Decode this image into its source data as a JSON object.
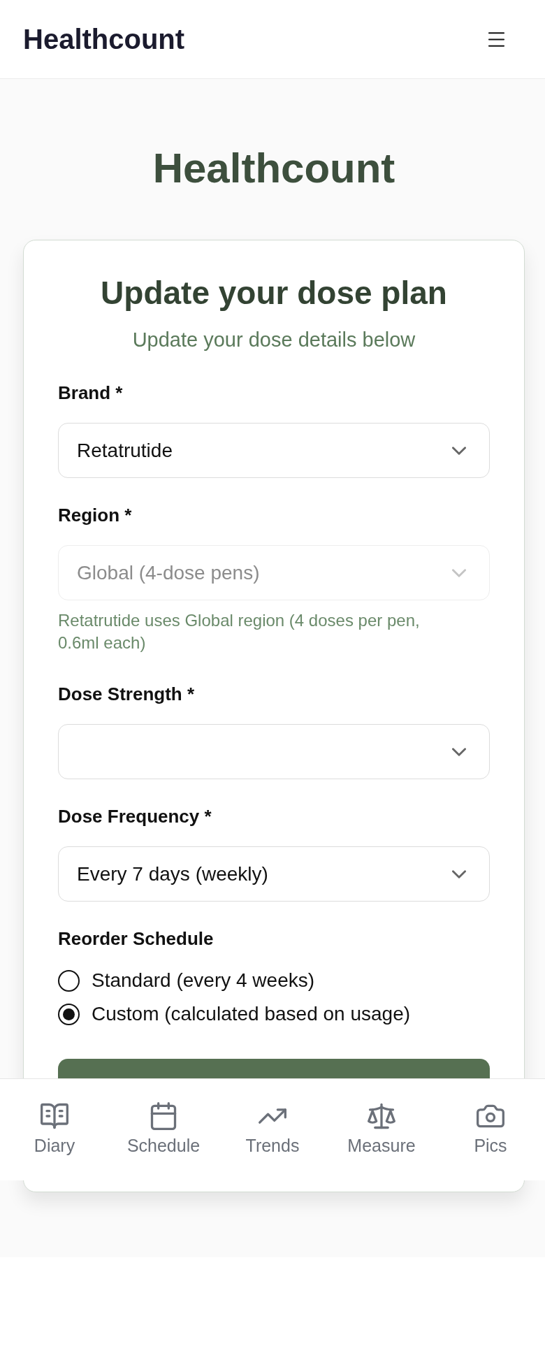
{
  "header": {
    "logo": "Healthcount"
  },
  "page": {
    "title": "Healthcount"
  },
  "card": {
    "title": "Update your dose plan",
    "subtitle": "Update your dose details below",
    "fields": [
      {
        "kind": "select",
        "label": "Brand *",
        "value": "Retatrutide",
        "disabled": false
      },
      {
        "kind": "select",
        "label": "Region *",
        "value": "Global (4-dose pens)",
        "disabled": true,
        "help": "Retatrutide uses Global region (4 doses per pen, 0.6ml each)"
      },
      {
        "kind": "select",
        "label": "Dose Strength *",
        "disabled": false
      },
      {
        "kind": "select",
        "label": "Dose Frequency *",
        "value": "Every 7 days (weekly)",
        "disabled": false
      }
    ],
    "reorder_schedule": {
      "label": "Reorder Schedule",
      "options": [
        {
          "label": "Standard (every 4 weeks)",
          "selected": false
        },
        {
          "label": "Custom (calculated based on usage)",
          "selected": true
        }
      ]
    },
    "actions": [
      {
        "kind": "primary"
      }
    ]
  },
  "bottom_nav": {
    "items": [
      {
        "label": "Diary"
      },
      {
        "label": "Schedule"
      },
      {
        "label": "Trends"
      },
      {
        "label": "Measure"
      },
      {
        "label": "Pics"
      }
    ]
  }
}
